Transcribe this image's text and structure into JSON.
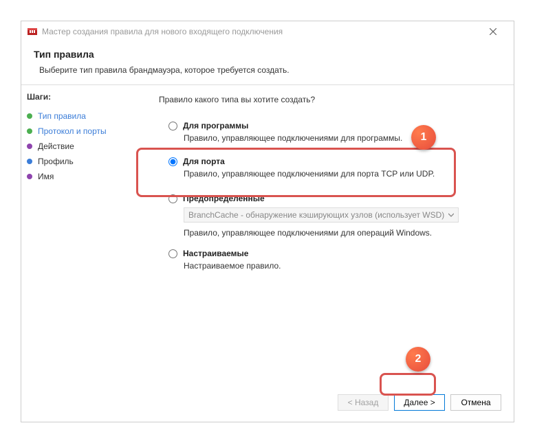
{
  "titlebar": {
    "text": "Мастер создания правила для нового входящего подключения"
  },
  "header": {
    "title": "Тип правила",
    "subtitle": "Выберите тип правила брандмауэра, которое требуется создать."
  },
  "sidebar": {
    "steps_label": "Шаги:",
    "items": [
      {
        "label": "Тип правила",
        "bullet": "green",
        "active": true
      },
      {
        "label": "Протокол и порты",
        "bullet": "green",
        "active": true
      },
      {
        "label": "Действие",
        "bullet": "purple",
        "active": false
      },
      {
        "label": "Профиль",
        "bullet": "blue",
        "active": false
      },
      {
        "label": "Имя",
        "bullet": "purple",
        "active": false
      }
    ]
  },
  "main": {
    "question": "Правило какого типа вы хотите создать?",
    "options": {
      "program": {
        "label": "Для программы",
        "desc": "Правило, управляющее подключениями для программы."
      },
      "port": {
        "label": "Для порта",
        "desc": "Правило, управляющее подключениями для порта TCP или UDP."
      },
      "predefined": {
        "label": "Предопределенные",
        "select_value": "BranchCache - обнаружение кэширующих узлов (использует WSD)",
        "desc": "Правило, управляющее подключениями для операций Windows."
      },
      "custom": {
        "label": "Настраиваемые",
        "desc": "Настраиваемое правило."
      }
    }
  },
  "footer": {
    "back": "< Назад",
    "next": "Далее >",
    "cancel": "Отмена"
  },
  "badges": {
    "one": "1",
    "two": "2"
  }
}
